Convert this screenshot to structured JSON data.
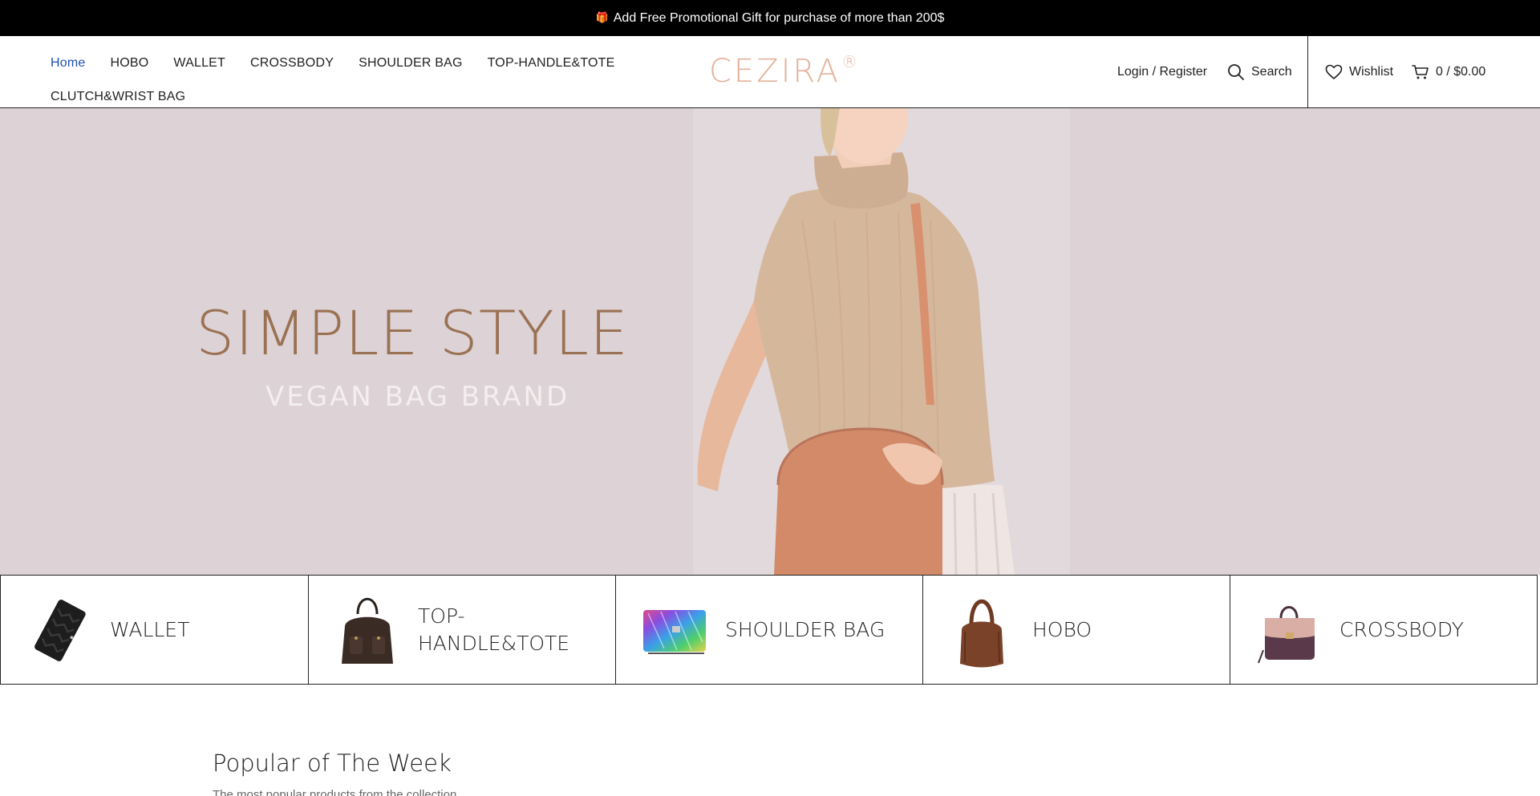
{
  "announcement": {
    "icon": "gift-icon",
    "text": "Add Free Promotional Gift for purchase of more than 200$"
  },
  "nav": {
    "items": [
      {
        "label": "Home",
        "active": true
      },
      {
        "label": "HOBO"
      },
      {
        "label": "WALLET"
      },
      {
        "label": "CROSSBODY"
      },
      {
        "label": "SHOULDER BAG"
      },
      {
        "label": "TOP-HANDLE&TOTE"
      },
      {
        "label": "CLUTCH&WRIST BAG"
      }
    ]
  },
  "logo": {
    "text": "CEZIRA",
    "mark": "®"
  },
  "header_right": {
    "login_label": "Login / Register",
    "search_label": "Search",
    "wishlist_label": "Wishlist",
    "cart_label": "0 / $0.00"
  },
  "hero": {
    "title": "SIMPLE STYLE",
    "subtitle": "VEGAN BAG BRAND"
  },
  "categories": [
    {
      "label": "WALLET",
      "icon": "wallet-image"
    },
    {
      "label": "TOP-HANDLE&TOTE",
      "icon": "tote-bag-image"
    },
    {
      "label": "SHOULDER BAG",
      "icon": "shoulder-bag-image"
    },
    {
      "label": "HOBO",
      "icon": "hobo-bag-image"
    },
    {
      "label": "CROSSBODY",
      "icon": "crossbody-bag-image"
    }
  ],
  "popular": {
    "title": "Popular of The Week",
    "subtitle": "The most popular products from the collection"
  },
  "colors": {
    "accent": "#1e4fb3",
    "logo": "#e4b29b",
    "hero_bg": "#ddd2d6",
    "hero_title": "#9a7253"
  }
}
